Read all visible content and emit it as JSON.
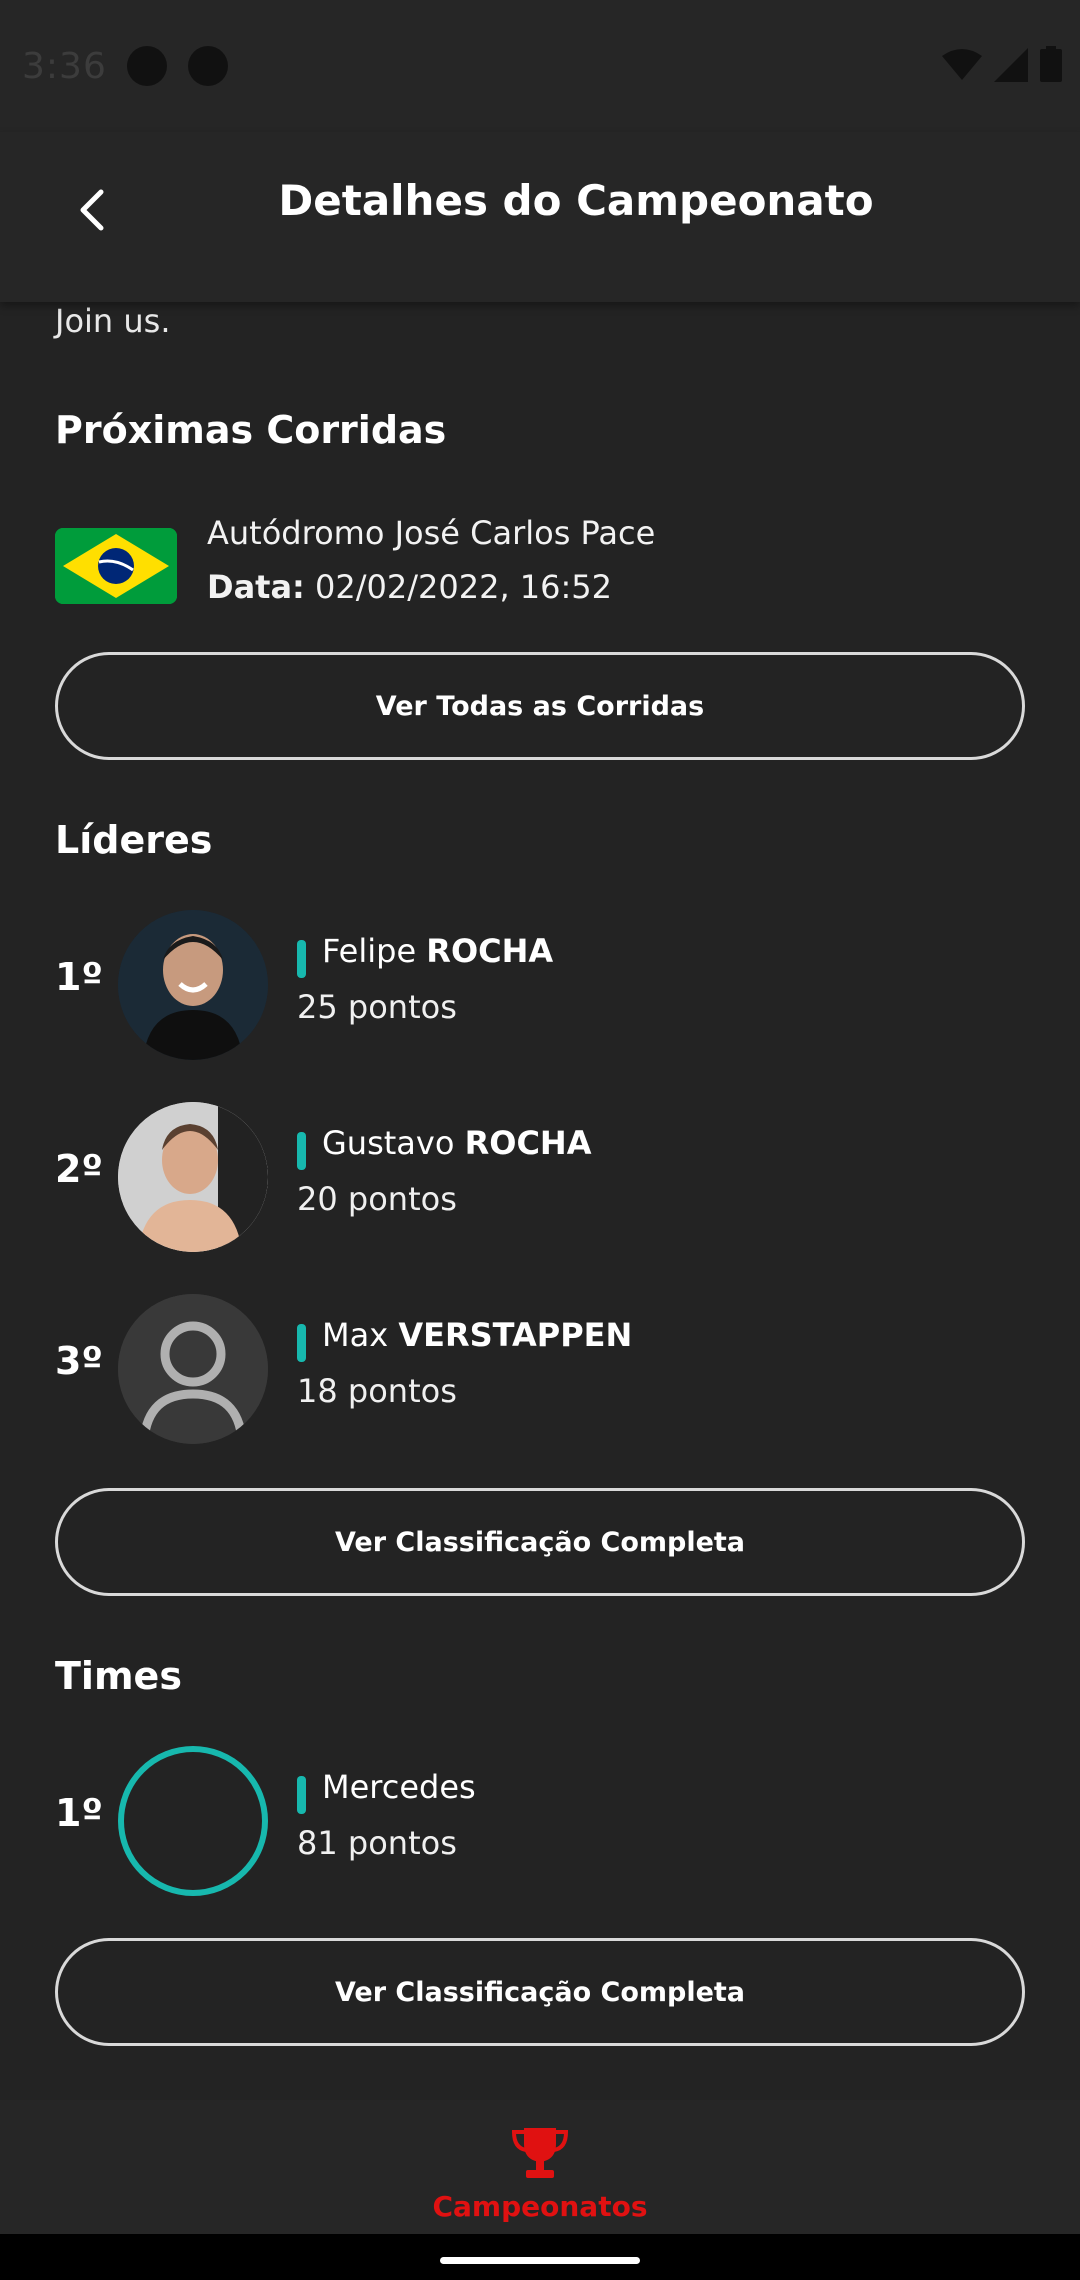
{
  "status_bar": {
    "time": "3:36"
  },
  "header": {
    "title": "Detalhes do Campeonato"
  },
  "intro_text": "Join us.",
  "races": {
    "title": "Próximas Corridas",
    "items": [
      {
        "flag": "brazil-flag",
        "name": "Autódromo José Carlos Pace",
        "date_label": "Data:",
        "date_value": "02/02/2022, 16:52"
      }
    ],
    "button_label": "Ver Todas as Corridas"
  },
  "leaders": {
    "title": "Líderes",
    "items": [
      {
        "rank": "1º",
        "first_name": "Felipe",
        "last_name": "ROCHA",
        "points": "25 pontos"
      },
      {
        "rank": "2º",
        "first_name": "Gustavo",
        "last_name": "ROCHA",
        "points": "20 pontos"
      },
      {
        "rank": "3º",
        "first_name": "Max",
        "last_name": "VERSTAPPEN",
        "points": "18 pontos"
      }
    ],
    "button_label": "Ver Classificação Completa"
  },
  "teams": {
    "title": "Times",
    "items": [
      {
        "rank": "1º",
        "name": "Mercedes",
        "points": "81 pontos"
      }
    ],
    "button_label": "Ver Classificação Completa"
  },
  "bottom_nav": {
    "items": [
      {
        "icon": "trophy-icon",
        "label": "Campeonatos"
      }
    ]
  },
  "colors": {
    "accent_teal": "#17b8ae",
    "nav_active": "#e01111",
    "background": "#232323"
  }
}
